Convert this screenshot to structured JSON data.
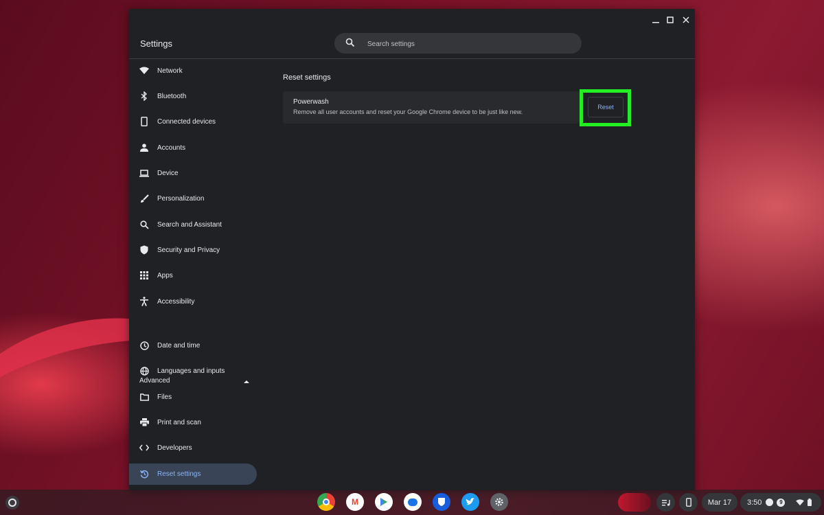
{
  "window": {
    "app_title": "Settings",
    "search_placeholder": "Search settings"
  },
  "sidebar": {
    "items": [
      {
        "label": "Network",
        "icon": "wifi-icon"
      },
      {
        "label": "Bluetooth",
        "icon": "bluetooth-icon"
      },
      {
        "label": "Connected devices",
        "icon": "phone-icon"
      },
      {
        "label": "Accounts",
        "icon": "person-icon"
      },
      {
        "label": "Device",
        "icon": "laptop-icon"
      },
      {
        "label": "Personalization",
        "icon": "brush-icon"
      },
      {
        "label": "Search and Assistant",
        "icon": "search-icon"
      },
      {
        "label": "Security and Privacy",
        "icon": "shield-icon"
      },
      {
        "label": "Apps",
        "icon": "grid-icon"
      },
      {
        "label": "Accessibility",
        "icon": "accessibility-icon"
      }
    ],
    "advanced_label": "Advanced",
    "advanced_items": [
      {
        "label": "Date and time",
        "icon": "clock-icon"
      },
      {
        "label": "Languages and inputs",
        "icon": "globe-icon"
      },
      {
        "label": "Files",
        "icon": "folder-icon"
      },
      {
        "label": "Print and scan",
        "icon": "printer-icon"
      },
      {
        "label": "Developers",
        "icon": "code-icon"
      },
      {
        "label": "Reset settings",
        "icon": "reset-icon",
        "active": true
      }
    ]
  },
  "main": {
    "section_title": "Reset settings",
    "powerwash": {
      "title": "Powerwash",
      "description": "Remove all user accounts and reset your Google Chrome device to be just like new.",
      "button_label": "Reset"
    }
  },
  "shelf": {
    "apps": [
      "chrome-icon",
      "gmail-icon",
      "play-store-icon",
      "messages-icon",
      "bitwarden-icon",
      "twitter-icon",
      "settings-icon"
    ],
    "date": "Mar 17",
    "time": "3:50",
    "notification_count": "9"
  },
  "colors": {
    "accent": "#8ab4f8",
    "highlight": "#22ee22",
    "window_bg": "#202124"
  }
}
